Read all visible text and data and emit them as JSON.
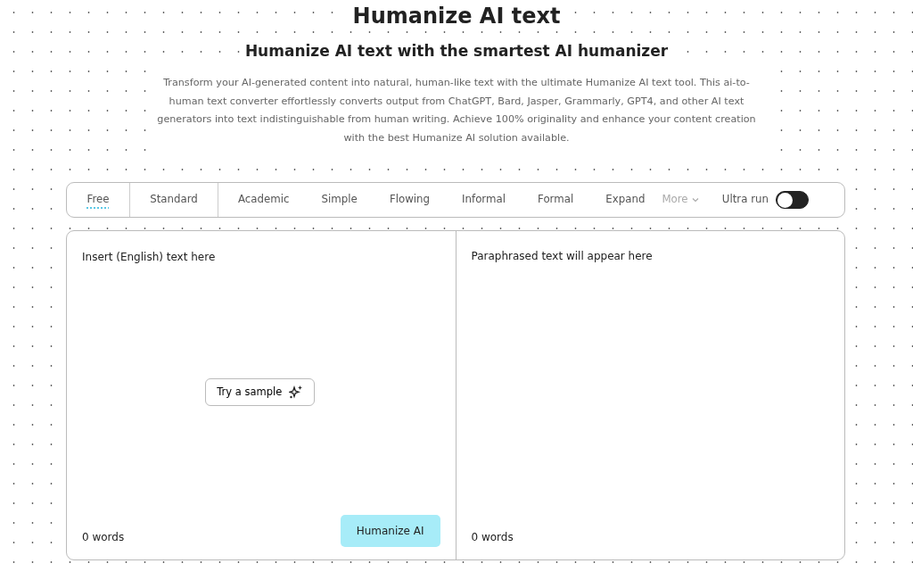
{
  "title": "Humanize AI text",
  "subtitle": "Humanize AI text with the smartest AI humanizer",
  "description": "Transform your AI-generated content into natural, human-like text with the ultimate Humanize AI text tool. This ai-to-human text converter effortlessly converts output from ChatGPT, Bard, Jasper, Grammarly, GPT4, and other AI text generators into text indistinguishable from human writing. Achieve 100% originality and enhance your content creation with the best Humanize AI solution available.",
  "modes": [
    {
      "label": "Free",
      "kind": "tab",
      "selected": true,
      "divider_after": true
    },
    {
      "label": "Standard",
      "kind": "tab",
      "selected": false,
      "divider_after": true
    },
    {
      "label": "Academic",
      "kind": "tab",
      "selected": false
    },
    {
      "label": "Simple",
      "kind": "tab",
      "selected": false
    },
    {
      "label": "Flowing",
      "kind": "tab",
      "selected": false
    },
    {
      "label": "Informal",
      "kind": "tab",
      "selected": false
    },
    {
      "label": "Formal",
      "kind": "tab",
      "selected": false
    },
    {
      "label": "Expand",
      "kind": "tab",
      "selected": false
    },
    {
      "label": "More",
      "kind": "menu",
      "selected": false
    }
  ],
  "ultra_run": {
    "label": "Ultra run",
    "on": false
  },
  "input": {
    "placeholder": "Insert (English) text here",
    "sample_button": "Try a sample",
    "word_count": "0 words",
    "action_button": "Humanize AI"
  },
  "output": {
    "placeholder": "Paraphrased text will appear here",
    "word_count": "0 words"
  }
}
